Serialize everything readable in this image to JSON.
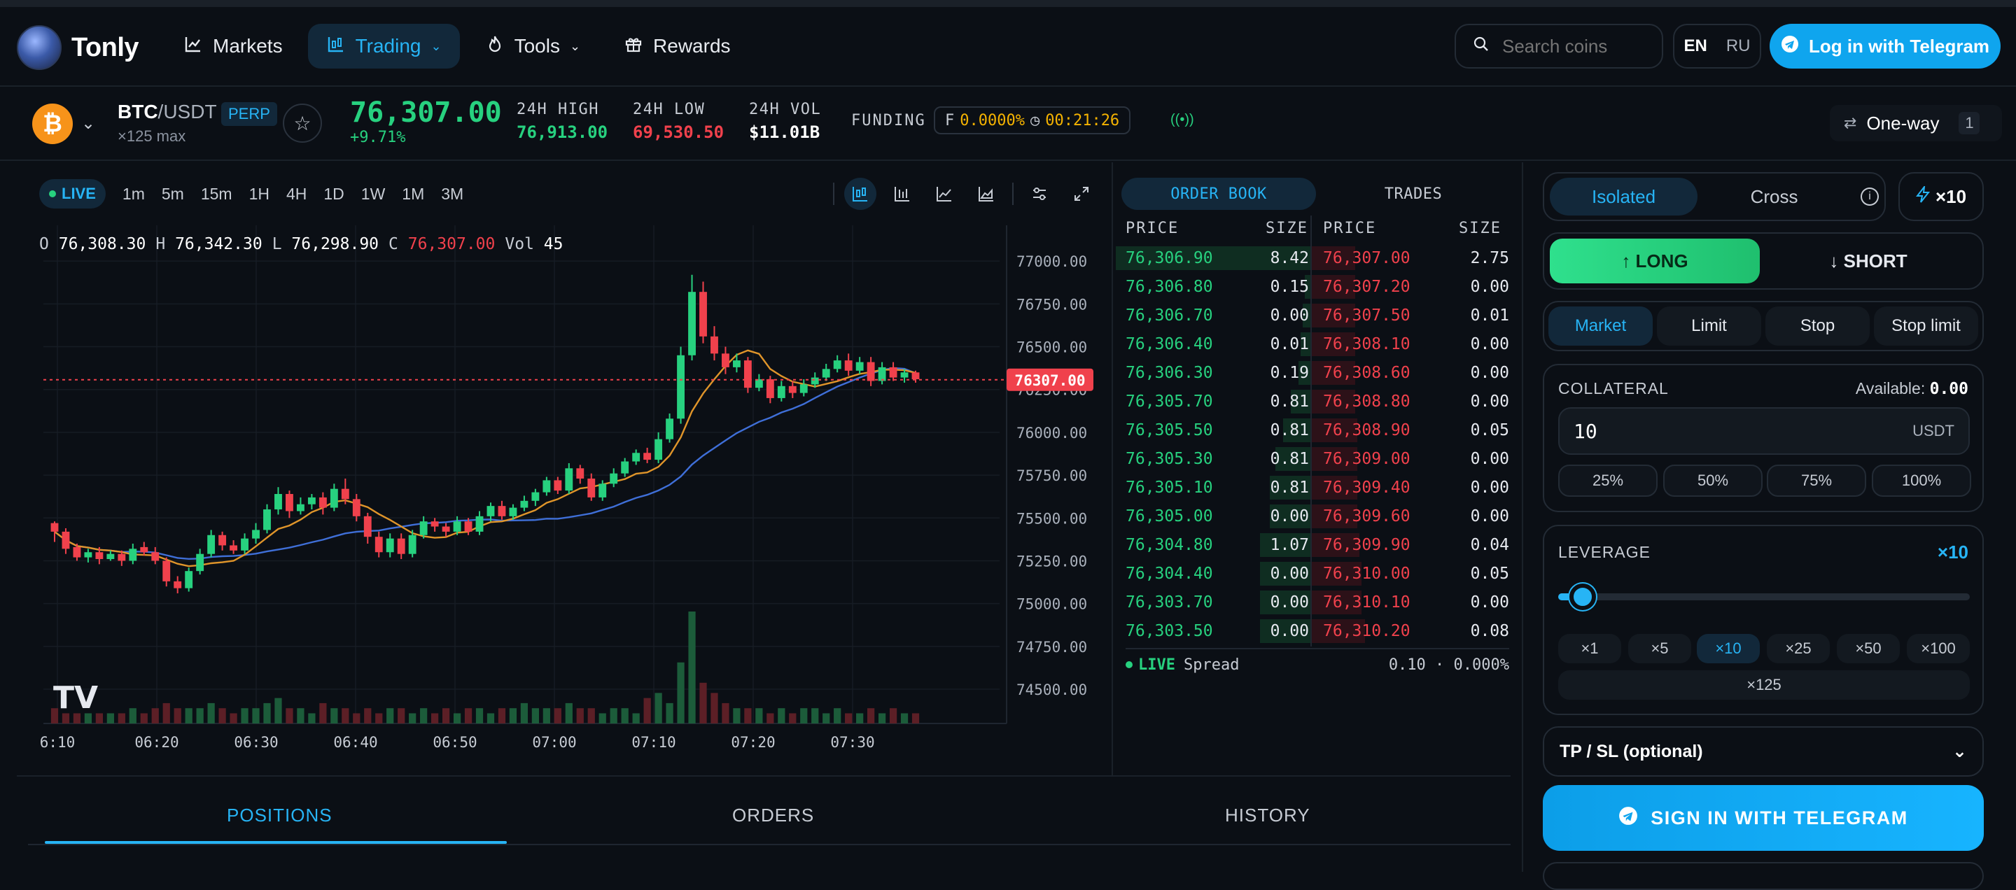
{
  "brand": {
    "name": "Tonly"
  },
  "nav": [
    {
      "label": "Markets",
      "icon": "chart-line-icon"
    },
    {
      "label": "Trading",
      "icon": "candles-icon"
    },
    {
      "label": "Tools",
      "icon": "flame-icon"
    },
    {
      "label": "Rewards",
      "icon": "gift-icon"
    }
  ],
  "search": {
    "placeholder": "Search coins"
  },
  "lang": {
    "en": "EN",
    "ru": "RU"
  },
  "login": {
    "label": "Log in with Telegram"
  },
  "ticker": {
    "base": "BTC",
    "quote": "/USDT",
    "type": "PERP",
    "max_leverage": "×125 max",
    "price": "76,307.00",
    "change": "+9.71%",
    "high_label": "24H HIGH",
    "high": "76,913.00",
    "low_label": "24H LOW",
    "low": "69,530.50",
    "vol_label": "24H VOL",
    "vol": "$11.01B",
    "funding_label": "FUNDING",
    "funding_f": "F",
    "funding_rate": "0.0000%",
    "funding_timer": "00:21:26",
    "position_mode": "One-way",
    "position_mode_count": "1"
  },
  "chart_toolbar": {
    "live": "LIVE",
    "timeframes": [
      "1m",
      "5m",
      "15m",
      "1H",
      "4H",
      "1D",
      "1W",
      "1M",
      "3M"
    ]
  },
  "ohlc": {
    "o_label": "O",
    "o": "76,308.30",
    "h_label": "H",
    "h": "76,342.30",
    "l_label": "L",
    "l": "76,298.90",
    "c_label": "C",
    "c": "76,307.00",
    "vol_label": "Vol",
    "vol": "45"
  },
  "colors": {
    "up": "#27d17f",
    "down": "#f0414c",
    "accent": "#27b4f5",
    "ma_fast": "#e0952a",
    "ma_slow": "#3f6fd8"
  },
  "chart_data": {
    "type": "candlestick",
    "y_ticks": [
      "77000.00",
      "76750.00",
      "76500.00",
      "76250.00",
      "76000.00",
      "75750.00",
      "75500.00",
      "75250.00",
      "75000.00",
      "74750.00",
      "74500.00"
    ],
    "x_ticks": [
      "6:10",
      "06:20",
      "06:30",
      "06:40",
      "06:50",
      "07:00",
      "07:10",
      "07:20",
      "07:30"
    ],
    "ylim": [
      74300,
      77070
    ],
    "last_price_label": "76307.00",
    "last_price": 76307,
    "watermark": "TV",
    "candles": [
      [
        75470,
        75420,
        75480,
        75360
      ],
      [
        75420,
        75320,
        75440,
        75290
      ],
      [
        75330,
        75270,
        75350,
        75250
      ],
      [
        75270,
        75300,
        75320,
        75240
      ],
      [
        75300,
        75260,
        75330,
        75230
      ],
      [
        75260,
        75290,
        75310,
        75250
      ],
      [
        75290,
        75250,
        75310,
        75220
      ],
      [
        75250,
        75320,
        75350,
        75230
      ],
      [
        75330,
        75300,
        75360,
        75280
      ],
      [
        75300,
        75250,
        75330,
        75230
      ],
      [
        75250,
        75130,
        75270,
        75100
      ],
      [
        75130,
        75090,
        75160,
        75060
      ],
      [
        75090,
        75190,
        75210,
        75070
      ],
      [
        75190,
        75290,
        75320,
        75170
      ],
      [
        75290,
        75400,
        75430,
        75270
      ],
      [
        75400,
        75340,
        75420,
        75310
      ],
      [
        75340,
        75310,
        75370,
        75290
      ],
      [
        75310,
        75380,
        75410,
        75290
      ],
      [
        75380,
        75430,
        75470,
        75350
      ],
      [
        75430,
        75550,
        75580,
        75410
      ],
      [
        75550,
        75640,
        75680,
        75520
      ],
      [
        75640,
        75540,
        75660,
        75500
      ],
      [
        75540,
        75580,
        75620,
        75520
      ],
      [
        75580,
        75620,
        75640,
        75550
      ],
      [
        75620,
        75560,
        75650,
        75520
      ],
      [
        75560,
        75670,
        75700,
        75540
      ],
      [
        75670,
        75610,
        75730,
        75580
      ],
      [
        75610,
        75510,
        75640,
        75480
      ],
      [
        75510,
        75390,
        75530,
        75350
      ],
      [
        75390,
        75300,
        75420,
        75270
      ],
      [
        75300,
        75380,
        75410,
        75270
      ],
      [
        75380,
        75290,
        75410,
        75260
      ],
      [
        75290,
        75400,
        75430,
        75270
      ],
      [
        75400,
        75480,
        75510,
        75380
      ],
      [
        75480,
        75450,
        75500,
        75420
      ],
      [
        75450,
        75420,
        75470,
        75390
      ],
      [
        75420,
        75480,
        75510,
        75400
      ],
      [
        75480,
        75420,
        75500,
        75400
      ],
      [
        75420,
        75510,
        75540,
        75400
      ],
      [
        75510,
        75570,
        75590,
        75480
      ],
      [
        75570,
        75510,
        75600,
        75490
      ],
      [
        75510,
        75560,
        75580,
        75490
      ],
      [
        75560,
        75600,
        75630,
        75540
      ],
      [
        75600,
        75650,
        75670,
        75570
      ],
      [
        75650,
        75720,
        75740,
        75630
      ],
      [
        75720,
        75660,
        75740,
        75640
      ],
      [
        75660,
        75790,
        75820,
        75640
      ],
      [
        75790,
        75730,
        75810,
        75700
      ],
      [
        75730,
        75620,
        75760,
        75600
      ],
      [
        75620,
        75700,
        75720,
        75600
      ],
      [
        75700,
        75760,
        75790,
        75680
      ],
      [
        75760,
        75830,
        75850,
        75740
      ],
      [
        75830,
        75880,
        75900,
        75810
      ],
      [
        75880,
        75840,
        75910,
        75820
      ],
      [
        75840,
        75960,
        76000,
        75820
      ],
      [
        75960,
        76080,
        76110,
        75940
      ],
      [
        76080,
        76450,
        76500,
        76050
      ],
      [
        76450,
        76820,
        76920,
        76420
      ],
      [
        76820,
        76560,
        76880,
        76520
      ],
      [
        76560,
        76460,
        76620,
        76420
      ],
      [
        76460,
        76380,
        76500,
        76340
      ],
      [
        76380,
        76420,
        76460,
        76350
      ],
      [
        76420,
        76260,
        76440,
        76230
      ],
      [
        76260,
        76310,
        76340,
        76240
      ],
      [
        76310,
        76200,
        76330,
        76170
      ],
      [
        76200,
        76270,
        76300,
        76180
      ],
      [
        76270,
        76230,
        76300,
        76200
      ],
      [
        76230,
        76280,
        76310,
        76210
      ],
      [
        76280,
        76320,
        76350,
        76260
      ],
      [
        76320,
        76370,
        76400,
        76300
      ],
      [
        76370,
        76420,
        76450,
        76350
      ],
      [
        76420,
        76360,
        76460,
        76330
      ],
      [
        76360,
        76410,
        76440,
        76340
      ],
      [
        76410,
        76300,
        76440,
        76270
      ],
      [
        76300,
        76380,
        76410,
        76280
      ],
      [
        76380,
        76320,
        76410,
        76300
      ],
      [
        76320,
        76350,
        76370,
        76290
      ],
      [
        76350,
        76310,
        76360,
        76290
      ]
    ],
    "volumes": [
      3,
      2,
      2,
      2,
      2,
      2,
      2,
      3,
      2,
      3,
      4,
      3,
      3,
      3,
      4,
      3,
      2,
      3,
      3,
      4,
      5,
      3,
      3,
      2,
      4,
      3,
      3,
      2,
      3,
      2,
      3,
      3,
      2,
      3,
      2,
      3,
      2,
      3,
      3,
      2,
      3,
      3,
      4,
      3,
      3,
      3,
      4,
      3,
      3,
      2,
      3,
      3,
      2,
      5,
      6,
      4,
      12,
      22,
      8,
      6,
      4,
      3,
      3,
      3,
      2,
      3,
      2,
      3,
      3,
      2,
      3,
      2,
      2,
      3,
      2,
      3,
      2,
      2
    ]
  },
  "order_book": {
    "tabs": [
      "ORDER BOOK",
      "TRADES"
    ],
    "headers": {
      "price": "PRICE",
      "size": "SIZE"
    },
    "bids": [
      {
        "price": "76,306.90",
        "size": "8.42",
        "depth": 1.0
      },
      {
        "price": "76,306.80",
        "size": "0.15",
        "depth": 0.03
      },
      {
        "price": "76,306.70",
        "size": "0.00",
        "depth": 0.04
      },
      {
        "price": "76,306.40",
        "size": "0.01",
        "depth": 0.05
      },
      {
        "price": "76,306.30",
        "size": "0.19",
        "depth": 0.06
      },
      {
        "price": "76,305.70",
        "size": "0.81",
        "depth": 0.1
      },
      {
        "price": "76,305.50",
        "size": "0.81",
        "depth": 0.14
      },
      {
        "price": "76,305.30",
        "size": "0.81",
        "depth": 0.18
      },
      {
        "price": "76,305.10",
        "size": "0.81",
        "depth": 0.21
      },
      {
        "price": "76,305.00",
        "size": "0.00",
        "depth": 0.21
      },
      {
        "price": "76,304.80",
        "size": "1.07",
        "depth": 0.26
      },
      {
        "price": "76,304.40",
        "size": "0.00",
        "depth": 0.26
      },
      {
        "price": "76,303.70",
        "size": "0.00",
        "depth": 0.26
      },
      {
        "price": "76,303.50",
        "size": "0.00",
        "depth": 0.26
      }
    ],
    "asks": [
      {
        "price": "76,307.00",
        "size": "2.75",
        "depth": 0.22
      },
      {
        "price": "76,307.20",
        "size": "0.00",
        "depth": 0.22
      },
      {
        "price": "76,307.50",
        "size": "0.01",
        "depth": 0.22
      },
      {
        "price": "76,308.10",
        "size": "0.00",
        "depth": 0.22
      },
      {
        "price": "76,308.60",
        "size": "0.00",
        "depth": 0.22
      },
      {
        "price": "76,308.80",
        "size": "0.00",
        "depth": 0.22
      },
      {
        "price": "76,308.90",
        "size": "0.05",
        "depth": 0.23
      },
      {
        "price": "76,309.00",
        "size": "0.00",
        "depth": 0.23
      },
      {
        "price": "76,309.40",
        "size": "0.00",
        "depth": 0.23
      },
      {
        "price": "76,309.60",
        "size": "0.00",
        "depth": 0.23
      },
      {
        "price": "76,309.90",
        "size": "0.04",
        "depth": 0.24
      },
      {
        "price": "76,310.00",
        "size": "0.05",
        "depth": 0.25
      },
      {
        "price": "76,310.10",
        "size": "0.00",
        "depth": 0.25
      },
      {
        "price": "76,310.20",
        "size": "0.08",
        "depth": 0.27
      }
    ],
    "spread_live": "LIVE",
    "spread_label": "Spread",
    "spread_value": "0.10 · 0.000%"
  },
  "bottom_tabs": [
    "POSITIONS",
    "ORDERS",
    "HISTORY"
  ],
  "trade_form": {
    "margin_modes": [
      "Isolated",
      "Cross"
    ],
    "leverage_pill": "×10",
    "long": "↑ LONG",
    "short": "↓ SHORT",
    "order_types": [
      "Market",
      "Limit",
      "Stop",
      "Stop limit"
    ],
    "collateral_label": "COLLATERAL",
    "available_label": "Available:",
    "available_value": "0.00",
    "collateral_value": "10",
    "collateral_unit": "USDT",
    "percent_buttons": [
      "25%",
      "50%",
      "75%",
      "100%"
    ],
    "leverage_label": "LEVERAGE",
    "leverage_value": "×10",
    "leverage_level": 0.06,
    "leverage_presets": [
      "×1",
      "×5",
      "×10",
      "×25",
      "×50",
      "×100"
    ],
    "leverage_max": "×125",
    "tpsl_label": "TP / SL (optional)",
    "signin_label": "SIGN IN WITH TELEGRAM"
  }
}
